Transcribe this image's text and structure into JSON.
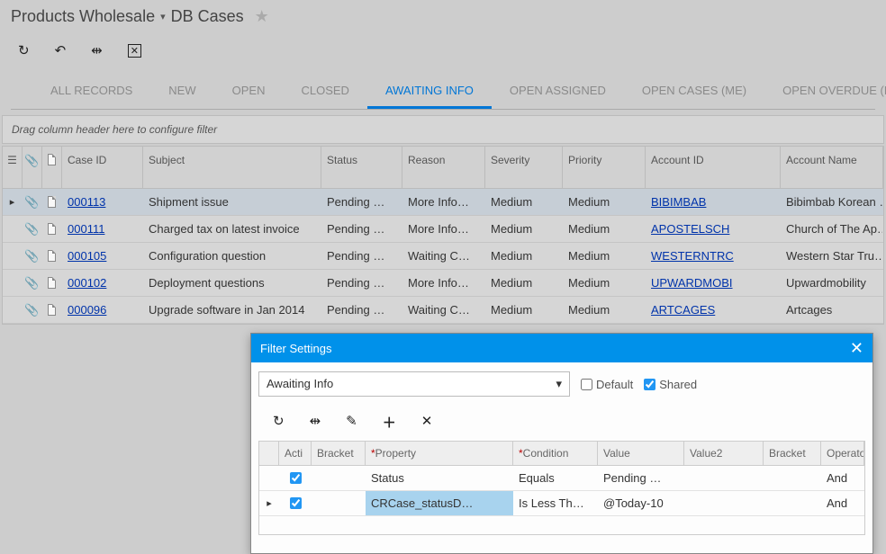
{
  "breadcrumb": {
    "item1": "Products Wholesale",
    "item2": "DB Cases"
  },
  "tabs": [
    {
      "label": "ALL RECORDS"
    },
    {
      "label": "NEW"
    },
    {
      "label": "OPEN"
    },
    {
      "label": "CLOSED"
    },
    {
      "label": "AWAITING INFO",
      "active": true
    },
    {
      "label": "OPEN ASSIGNED"
    },
    {
      "label": "OPEN CASES (ME)"
    },
    {
      "label": "OPEN OVERDUE (ME)"
    }
  ],
  "filter_hint": "Drag column header here to configure filter",
  "columns": {
    "case_id": "Case ID",
    "subject": "Subject",
    "status": "Status",
    "reason": "Reason",
    "severity": "Severity",
    "priority": "Priority",
    "account_id": "Account ID",
    "account_name": "Account Name"
  },
  "rows": [
    {
      "case_id": "000113",
      "subject": "Shipment issue",
      "status": "Pending …",
      "reason": "More Info…",
      "severity": "Medium",
      "priority": "Medium",
      "account_id": "BIBIMBAB",
      "account_name": "Bibimbab Korean …",
      "selected": true,
      "expand": true
    },
    {
      "case_id": "000111",
      "subject": "Charged tax on latest invoice",
      "status": "Pending …",
      "reason": "More Info…",
      "severity": "Medium",
      "priority": "Medium",
      "account_id": "APOSTELSCH",
      "account_name": "Church of The Ap…"
    },
    {
      "case_id": "000105",
      "subject": "Configuration question",
      "status": "Pending …",
      "reason": "Waiting C…",
      "severity": "Medium",
      "priority": "Medium",
      "account_id": "WESTERNTRC",
      "account_name": "Western Star Tru…"
    },
    {
      "case_id": "000102",
      "subject": "Deployment questions",
      "status": "Pending …",
      "reason": "More Info…",
      "severity": "Medium",
      "priority": "Medium",
      "account_id": "UPWARDMOBI",
      "account_name": "Upwardmobility"
    },
    {
      "case_id": "000096",
      "subject": "Upgrade software in Jan 2014",
      "status": "Pending …",
      "reason": "Waiting C…",
      "severity": "Medium",
      "priority": "Medium",
      "account_id": "ARTCAGES",
      "account_name": "Artcages"
    }
  ],
  "dialog": {
    "title": "Filter Settings",
    "filter_name": "Awaiting Info",
    "default_label": "Default",
    "default_checked": false,
    "shared_label": "Shared",
    "shared_checked": true,
    "columns": {
      "active": "Acti",
      "bracket1": "Bracket",
      "property": "Property",
      "condition": "Condition",
      "value": "Value",
      "value2": "Value2",
      "bracket2": "Bracket",
      "operator": "Operato"
    },
    "rows": [
      {
        "active": true,
        "bracket1": "",
        "property": "Status",
        "condition": "Equals",
        "value": "Pending …",
        "value2": "",
        "bracket2": "",
        "operator": "And"
      },
      {
        "active": true,
        "bracket1": "",
        "property": "CRCase_statusD…",
        "condition": "Is Less Th…",
        "value": "@Today-10",
        "value2": "",
        "bracket2": "",
        "operator": "And",
        "selected": true
      }
    ]
  }
}
